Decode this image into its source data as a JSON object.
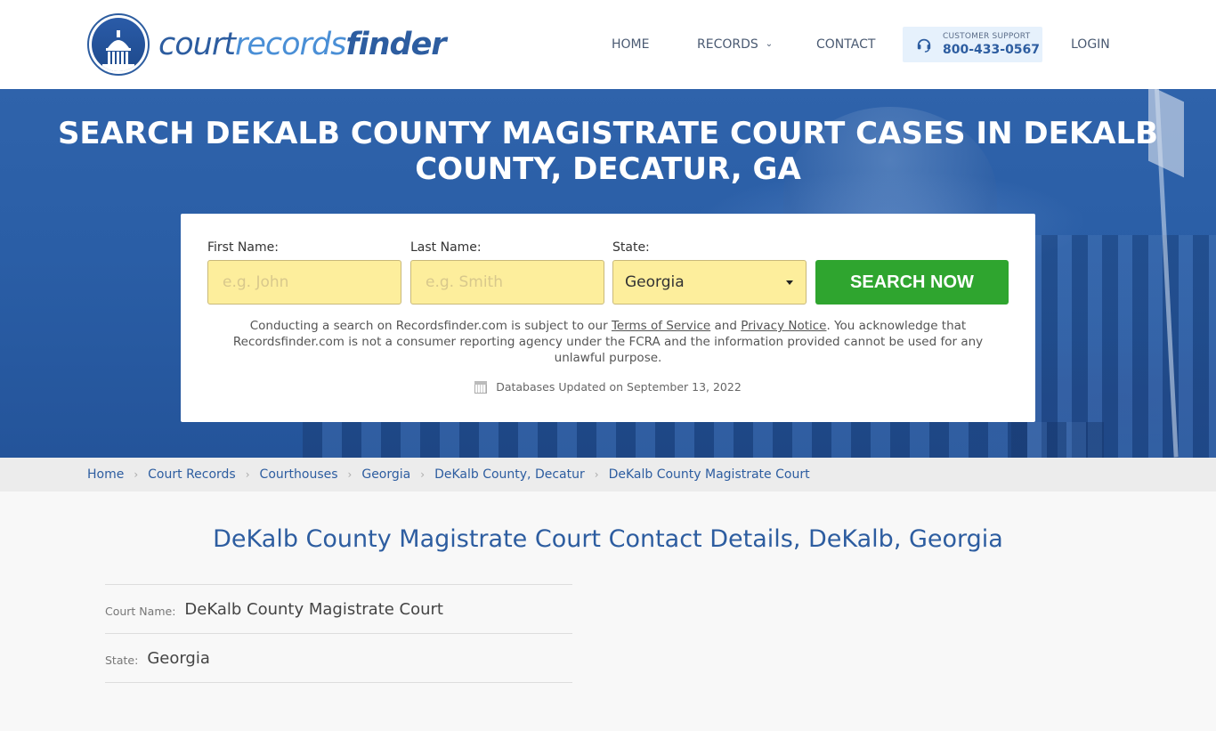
{
  "header": {
    "logo": {
      "part1": "court",
      "part2": "records",
      "part3": "finder"
    },
    "nav": {
      "home": "HOME",
      "records": "RECORDS",
      "contact": "CONTACT",
      "login": "LOGIN"
    },
    "support": {
      "label": "CUSTOMER SUPPORT",
      "phone": "800-433-0567",
      "icon": "headset-icon"
    }
  },
  "hero": {
    "title": "SEARCH DEKALB COUNTY MAGISTRATE COURT CASES IN DEKALB COUNTY, DECATUR, GA"
  },
  "search": {
    "first_name": {
      "label": "First Name:",
      "placeholder": "e.g. John",
      "value": ""
    },
    "last_name": {
      "label": "Last Name:",
      "placeholder": "e.g. Smith",
      "value": ""
    },
    "state": {
      "label": "State:",
      "selected": "Georgia"
    },
    "button": "SEARCH NOW",
    "colors": {
      "input_bg": "#fdee9c",
      "button_bg": "#2fa52f"
    },
    "disclaimer": {
      "pre": "Conducting a search on Recordsfinder.com is subject to our ",
      "terms": "Terms of Service",
      "and": " and ",
      "privacy": "Privacy Notice",
      "post": ". You acknowledge that Recordsfinder.com is not a consumer reporting agency under the FCRA and the information provided cannot be used for any unlawful purpose."
    },
    "updated": "Databases Updated on September 13, 2022"
  },
  "breadcrumb": [
    "Home",
    "Court Records",
    "Courthouses",
    "Georgia",
    "DeKalb County, Decatur",
    "DeKalb County Magistrate Court"
  ],
  "content": {
    "title": "DeKalb County Magistrate Court Contact Details, DeKalb, Georgia",
    "details": [
      {
        "label": "Court Name:",
        "value": "DeKalb County Magistrate Court"
      },
      {
        "label": "State:",
        "value": "Georgia"
      }
    ]
  },
  "colors": {
    "brand": "#2d5da0",
    "hero": "#2a5ea6"
  }
}
